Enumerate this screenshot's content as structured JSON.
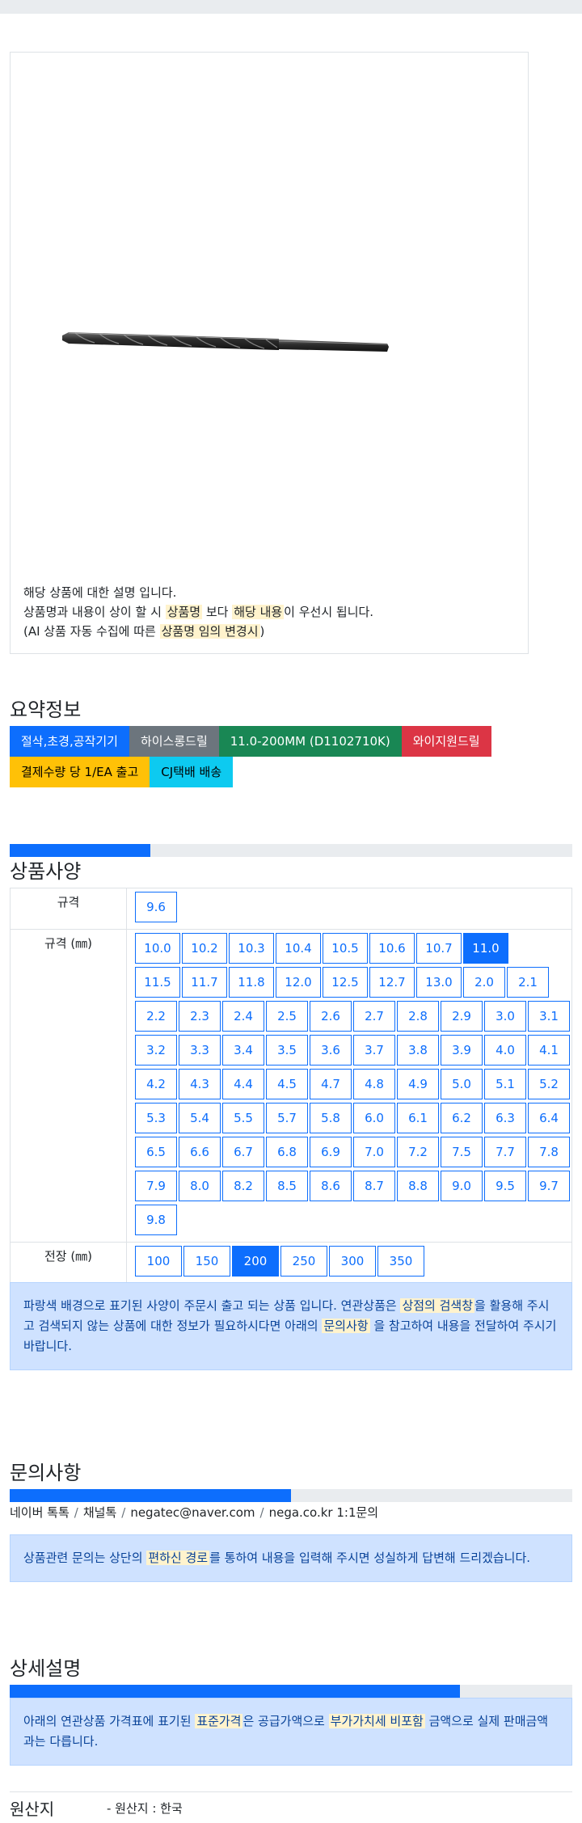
{
  "notice": {
    "line1": "해당 상품에 대한 설명 입니다.",
    "line2_a": "상품명과 내용이 상이 할 시 ",
    "line2_hl1": "상품명",
    "line2_b": " 보다 ",
    "line2_hl2": "해당 내용",
    "line2_c": "이 우선시 됩니다.",
    "line3_a": "(AI 상품 자동 수집에 따른 ",
    "line3_hl": "상품명 임의 변경시",
    "line3_b": ")"
  },
  "summary": {
    "title": "요약정보",
    "row1": [
      {
        "label": "절삭,초경,공작기기",
        "color": "#0d6efd"
      },
      {
        "label": "하이스롱드릴",
        "color": "#6c757d"
      },
      {
        "label": "11.0-200MM (D1102710K)",
        "color": "#198754"
      },
      {
        "label": "와이지원드릴",
        "color": "#dc3545"
      }
    ],
    "row2": [
      {
        "label": "결제수량 당 1/EA 출고",
        "color": "#ffc107"
      },
      {
        "label": "CJ택배 배송",
        "color": "#0dcaf0"
      }
    ]
  },
  "specs": {
    "title": "상품사양",
    "progress": 0.25,
    "rows": [
      {
        "label": "규격",
        "lines": [
          [
            "9.6"
          ]
        ],
        "selected": ""
      },
      {
        "label": "규격 (㎜)",
        "lines": [
          [
            "10.0",
            "10.2",
            "10.3",
            "10.4",
            "10.5",
            "10.6",
            "10.7",
            "11.0"
          ],
          [
            "11.5",
            "11.7",
            "11.8",
            "12.0",
            "12.5",
            "12.7",
            "13.0",
            "2.0",
            "2.1"
          ],
          [
            "2.2",
            "2.3",
            "2.4",
            "2.5",
            "2.6",
            "2.7",
            "2.8",
            "2.9",
            "3.0",
            "3.1"
          ],
          [
            "3.2",
            "3.3",
            "3.4",
            "3.5",
            "3.6",
            "3.7",
            "3.8",
            "3.9",
            "4.0",
            "4.1"
          ],
          [
            "4.2",
            "4.3",
            "4.4",
            "4.5",
            "4.7",
            "4.8",
            "4.9",
            "5.0",
            "5.1",
            "5.2"
          ],
          [
            "5.3",
            "5.4",
            "5.5",
            "5.7",
            "5.8",
            "6.0",
            "6.1",
            "6.2",
            "6.3",
            "6.4"
          ],
          [
            "6.5",
            "6.6",
            "6.7",
            "6.8",
            "6.9",
            "7.0",
            "7.2",
            "7.5",
            "7.7",
            "7.8"
          ],
          [
            "7.9",
            "8.0",
            "8.2",
            "8.5",
            "8.6",
            "8.7",
            "8.8",
            "9.0",
            "9.5",
            "9.7"
          ],
          [
            "9.8"
          ]
        ],
        "selected": "11.0"
      },
      {
        "label": "전장 (㎜)",
        "lines": [
          [
            "100",
            "150",
            "200",
            "250",
            "300",
            "350"
          ]
        ],
        "selected": "200"
      }
    ],
    "info_a": "파랑색 배경으로 표기된 사양이 주문시 출고 되는 상품 입니다. 연관상품은 ",
    "info_hl1": "상점의 검색창",
    "info_b": "을 활용해 주시고 검색되지 않는 상품에 대한 정보가 필요하시다면 아래의 ",
    "info_hl2": "문의사항",
    "info_c": " 을 참고하여 내용을 전달하여 주시기 바랍니다."
  },
  "inquiry": {
    "title": "문의사항",
    "progress": 0.5,
    "contacts": [
      "네이버 톡톡",
      "채널톡",
      "negatec@naver.com",
      "nega.co.kr 1:1문의"
    ],
    "separator": "/",
    "info_a": "상품관련 문의는 상단의 ",
    "info_hl": "편하신 경로",
    "info_b": "를 통하여 내용을 입력해 주시면 성실하게 답변해 드리겠습니다."
  },
  "detail": {
    "title": "상세설명",
    "progress": 0.8,
    "info_a": "아래의 연관상품 가격표에 표기된 ",
    "info_hl1": "표준가격",
    "info_b": "은 공급가액으로 ",
    "info_hl2": "부가가치세 비포함",
    "info_c": " 금액으로 실제 판매금액과는 다릅니다."
  },
  "origin": {
    "label": "원산지",
    "value": "- 원산지 : 한국"
  },
  "colors": {
    "primary": "#0d6efd",
    "info_bg": "#cfe2ff",
    "highlight": "#fff3cd"
  }
}
